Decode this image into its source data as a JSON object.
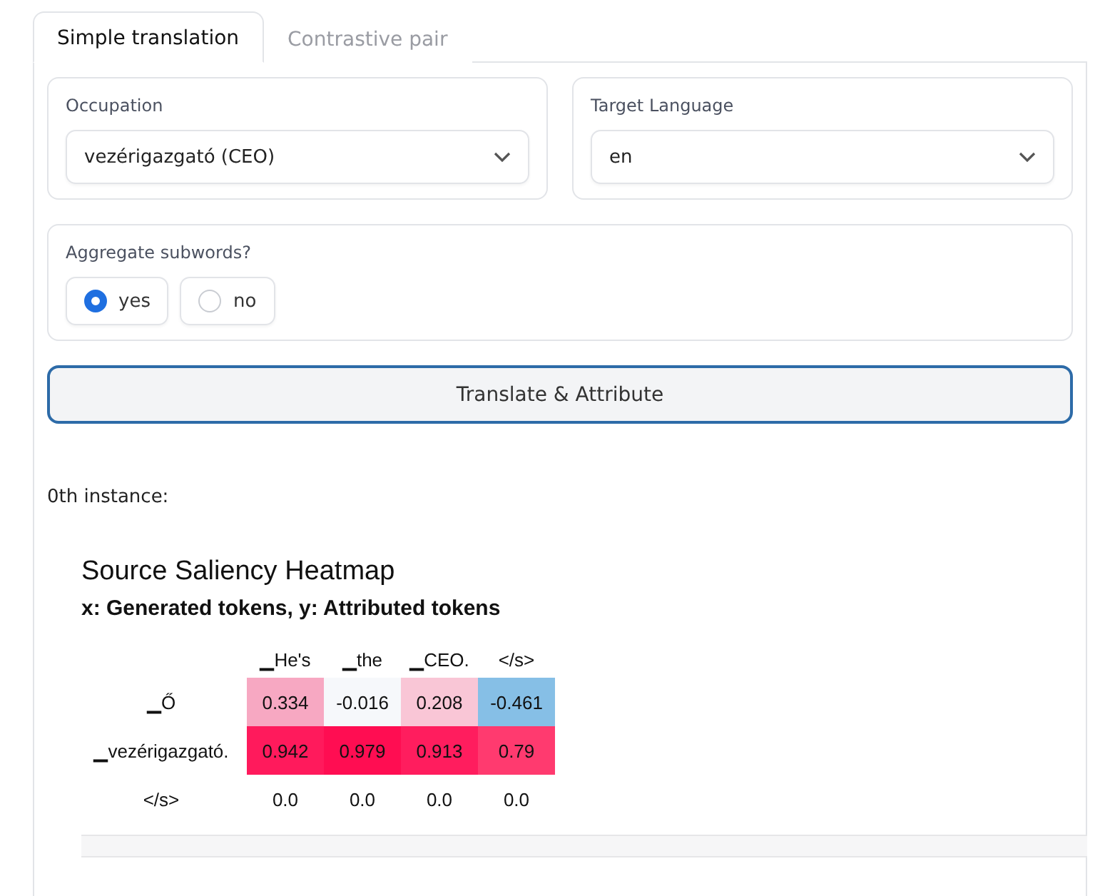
{
  "tabs": [
    {
      "label": "Simple translation",
      "selected": true
    },
    {
      "label": "Contrastive pair",
      "selected": false
    }
  ],
  "occupation": {
    "label": "Occupation",
    "value": "vezérigazgató (CEO)"
  },
  "target_language": {
    "label": "Target Language",
    "value": "en"
  },
  "aggregate": {
    "label": "Aggregate subwords?",
    "options": [
      {
        "label": "yes",
        "selected": true
      },
      {
        "label": "no",
        "selected": false
      }
    ]
  },
  "button": "Translate & Attribute",
  "instance_label": "0th instance:",
  "heatmap": {
    "title": "Source Saliency Heatmap",
    "subtitle": "x: Generated tokens, y: Attributed tokens",
    "columns": [
      "▁He's",
      "▁the",
      "▁CEO.",
      "</s>"
    ],
    "rows": [
      {
        "label": "▁Ő",
        "cells": [
          {
            "value": "0.334",
            "color": "#f7a8c2"
          },
          {
            "value": "-0.016",
            "color": "#f6f8fb"
          },
          {
            "value": "0.208",
            "color": "#f9c6d6"
          },
          {
            "value": "-0.461",
            "color": "#86bfe6"
          }
        ]
      },
      {
        "label": "▁vezérigazgató.",
        "cells": [
          {
            "value": "0.942",
            "color": "#ff1a5c"
          },
          {
            "value": "0.979",
            "color": "#ff0d52"
          },
          {
            "value": "0.913",
            "color": "#ff1d5e"
          },
          {
            "value": "0.79",
            "color": "#ff3a6f"
          }
        ]
      },
      {
        "label": "</s>",
        "cells": [
          {
            "value": "0.0"
          },
          {
            "value": "0.0"
          },
          {
            "value": "0.0"
          },
          {
            "value": "0.0"
          }
        ]
      }
    ]
  }
}
